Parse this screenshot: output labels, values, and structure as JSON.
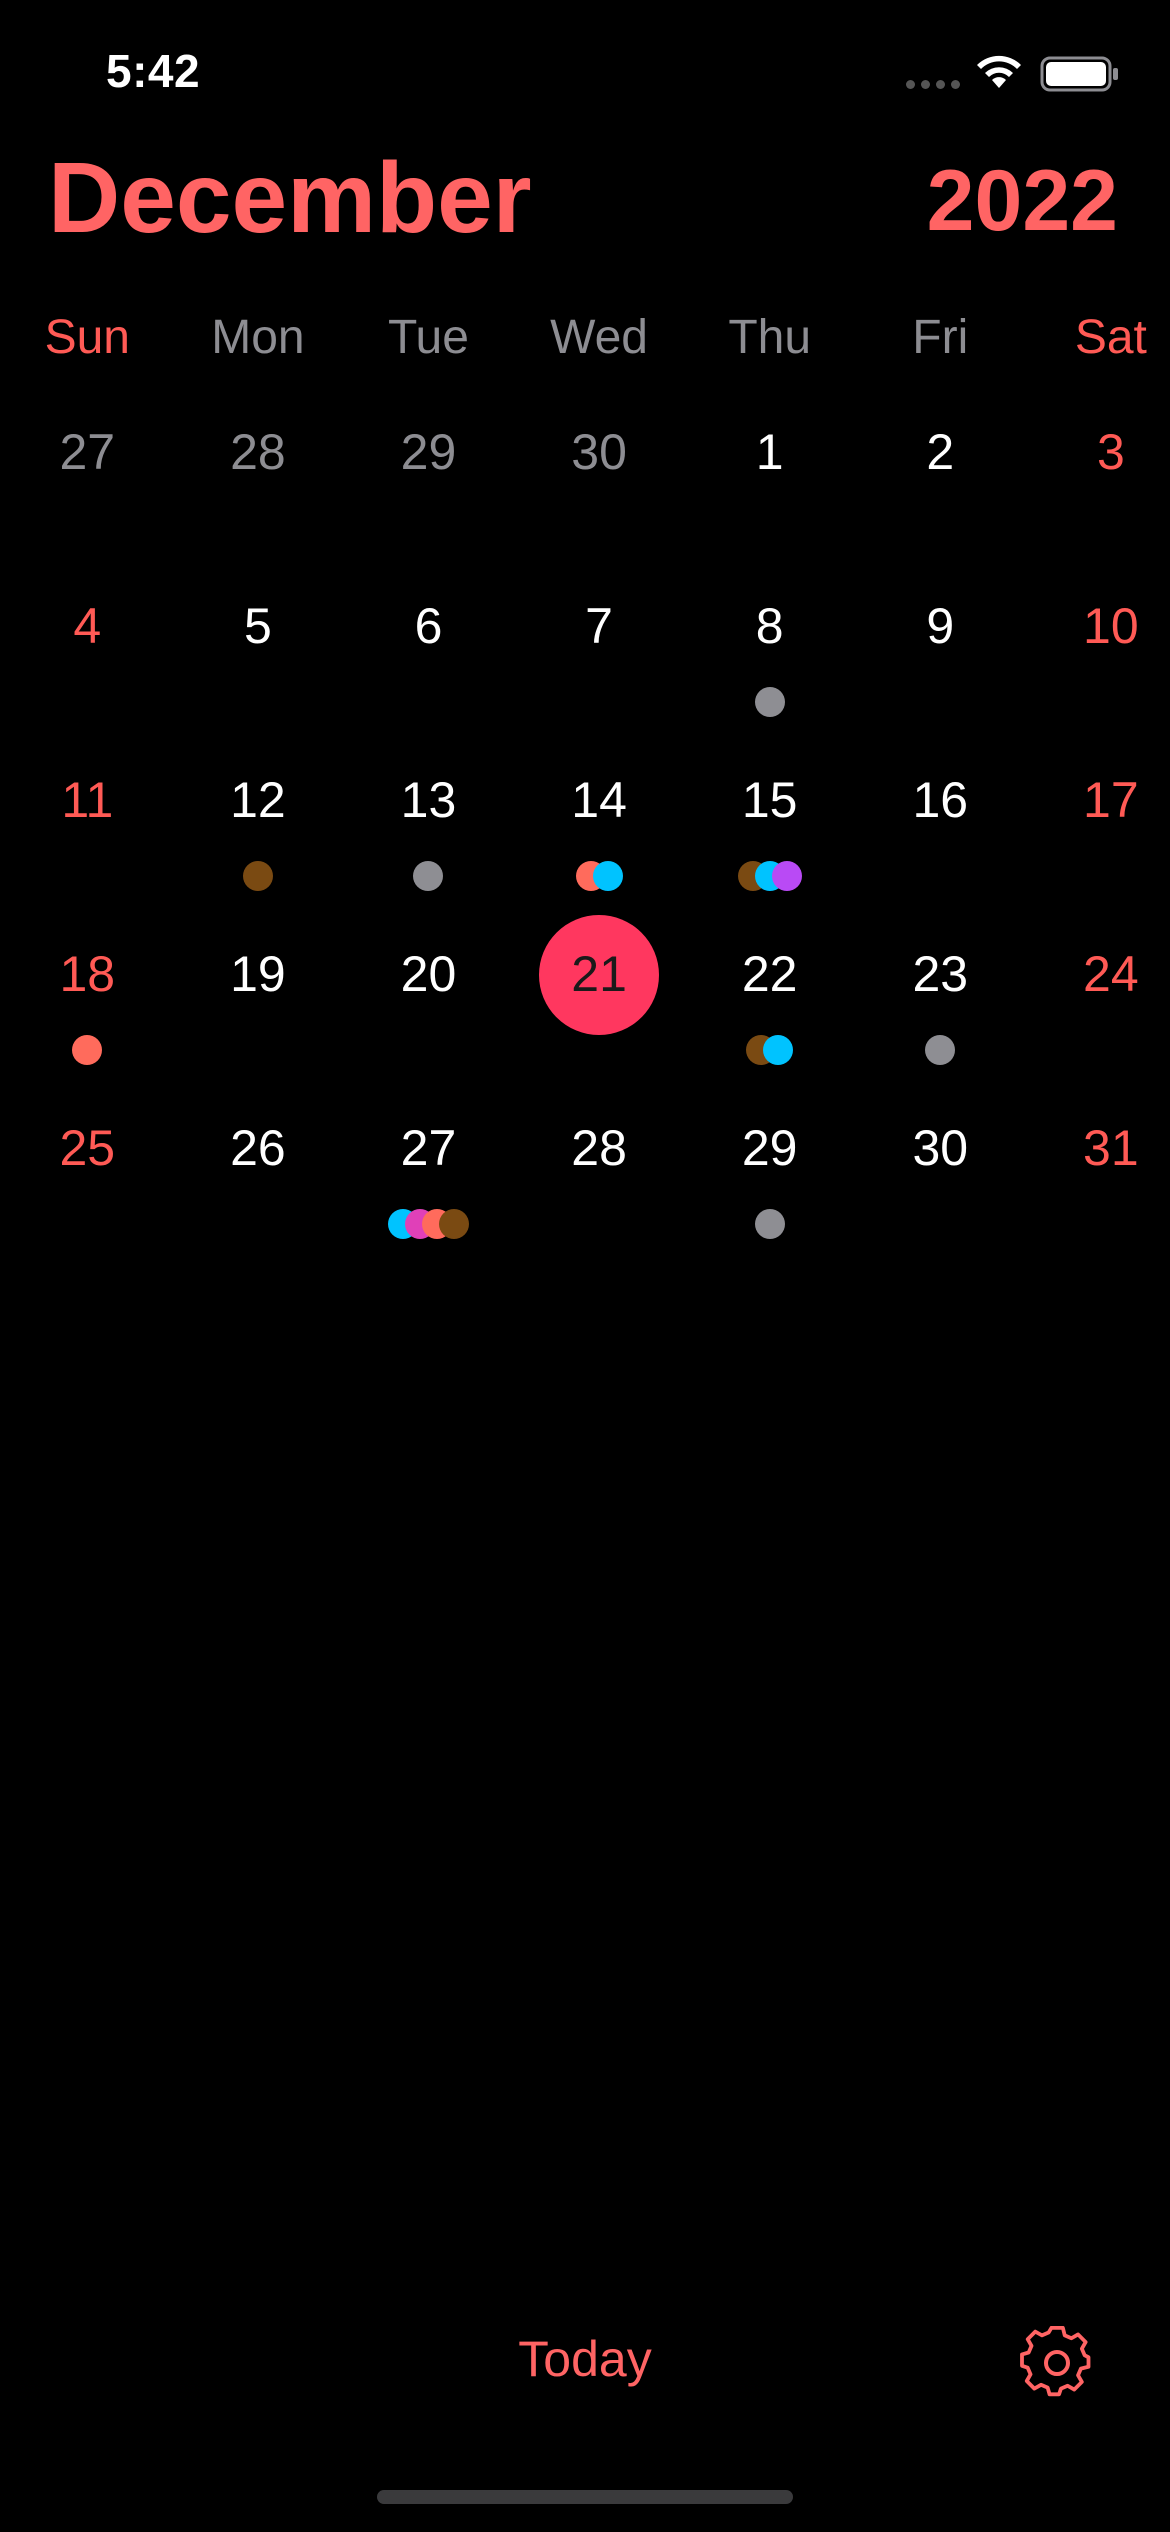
{
  "status_bar": {
    "time": "5:42",
    "icons": [
      "cellular-signal-icon",
      "wifi-icon",
      "battery-icon"
    ]
  },
  "header": {
    "month": "December",
    "year": "2022"
  },
  "weekdays": [
    "Sun",
    "Mon",
    "Tue",
    "Wed",
    "Thu",
    "Fri",
    "Sat"
  ],
  "colors": {
    "accent": "#ff6464",
    "weekend": "#ff5a55",
    "today_circle": "#ff375f",
    "muted": "#8d8d92",
    "event_gray": "#8e8e93",
    "event_brown": "#7a4a12",
    "event_cyan": "#00c3ff",
    "event_salmon": "#ff6b5c",
    "event_purple": "#b94af5",
    "event_magenta": "#e040b8"
  },
  "calendar": {
    "today": "21",
    "days": [
      {
        "num": "27",
        "other": true
      },
      {
        "num": "28",
        "other": true
      },
      {
        "num": "29",
        "other": true
      },
      {
        "num": "30",
        "other": true
      },
      {
        "num": "1"
      },
      {
        "num": "2"
      },
      {
        "num": "3"
      },
      {
        "num": "4"
      },
      {
        "num": "5"
      },
      {
        "num": "6"
      },
      {
        "num": "7"
      },
      {
        "num": "8",
        "events": [
          "#8e8e93"
        ]
      },
      {
        "num": "9"
      },
      {
        "num": "10"
      },
      {
        "num": "11"
      },
      {
        "num": "12",
        "events": [
          "#7a4a12"
        ]
      },
      {
        "num": "13",
        "events": [
          "#8e8e93"
        ]
      },
      {
        "num": "14",
        "events": [
          "#ff6b5c",
          "#00c3ff"
        ]
      },
      {
        "num": "15",
        "events": [
          "#7a4a12",
          "#00c3ff",
          "#b94af5"
        ]
      },
      {
        "num": "16"
      },
      {
        "num": "17"
      },
      {
        "num": "18",
        "events": [
          "#ff6b5c"
        ]
      },
      {
        "num": "19"
      },
      {
        "num": "20"
      },
      {
        "num": "21",
        "today": true
      },
      {
        "num": "22",
        "events": [
          "#7a4a12",
          "#00c3ff"
        ]
      },
      {
        "num": "23",
        "events": [
          "#8e8e93"
        ]
      },
      {
        "num": "24"
      },
      {
        "num": "25"
      },
      {
        "num": "26"
      },
      {
        "num": "27",
        "events": [
          "#00c3ff",
          "#e040b8",
          "#ff6b5c",
          "#7a4a12"
        ]
      },
      {
        "num": "28"
      },
      {
        "num": "29",
        "events": [
          "#8e8e93"
        ]
      },
      {
        "num": "30"
      },
      {
        "num": "31"
      }
    ]
  },
  "footer": {
    "today_label": "Today",
    "settings_icon": "gear-icon"
  }
}
